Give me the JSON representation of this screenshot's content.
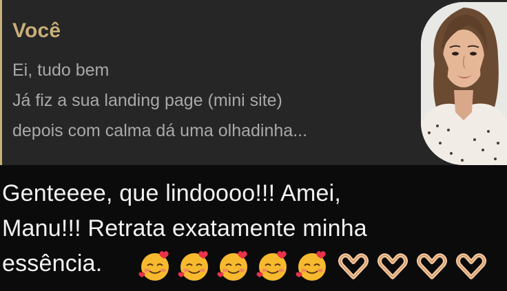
{
  "quote": {
    "author": "Você",
    "lines": [
      "Ei, tudo bem",
      "Já fiz a sua landing page (mini site)",
      "depois com calma dá uma olhadinha..."
    ]
  },
  "reply": {
    "lines": [
      "Genteeee, que lindoooo!!! Amei,",
      "Manu!!! Retrata exatamente minha",
      "essência."
    ],
    "emojis": [
      "smiling-face-with-hearts",
      "smiling-face-with-hearts",
      "smiling-face-with-hearts",
      "smiling-face-with-hearts",
      "smiling-face-with-hearts",
      "heart-hands",
      "heart-hands",
      "heart-hands",
      "heart-hands"
    ]
  },
  "colors": {
    "background": "#0b0b0c",
    "quote_background": "#262626",
    "quote_accent": "#c8ae79",
    "quote_text": "#a9a9a9",
    "reply_text": "#f3f3f3"
  }
}
